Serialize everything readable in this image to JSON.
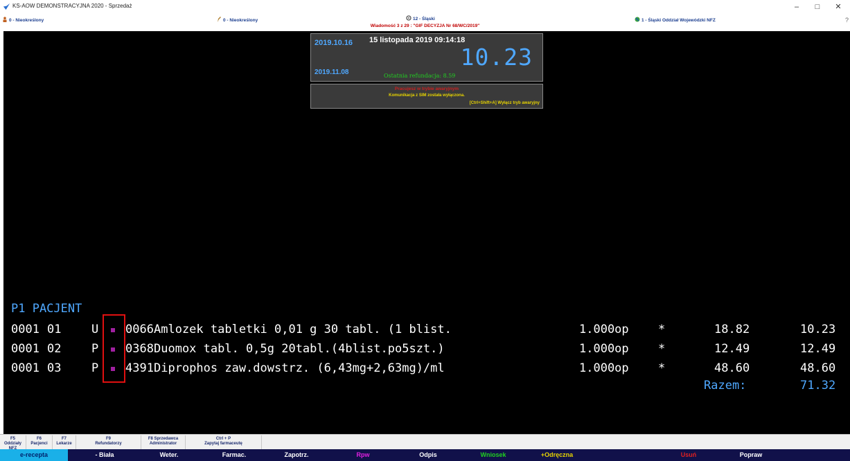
{
  "window": {
    "title": "KS-AOW DEMONSTRACYJNA 2020 - Sprzedaż",
    "minimize": "–",
    "maximize": "□",
    "close": "✕"
  },
  "status": {
    "left1": "0 - Nieokreślony",
    "left2": "0 - Nieokreślony",
    "region": "12 - Śląski",
    "message": "Wiadomość 3 z 29 : \"GIF DECYZJA Nr 68/WC/2019\"",
    "nfz": "1 - Śląski Oddział Wojewódzki NFZ",
    "right_icon": "?"
  },
  "clock": {
    "date1": "2019.10.16",
    "date2": "2019.11.08",
    "datetime": "15 listopada 2019  09:14:18",
    "value": "10.23",
    "last_refund": "Ostatnia refundacja: 8.59"
  },
  "alert": {
    "line1": "Pracujesz w trybie awaryjnym",
    "line2": "Komunikacja z SIM została wyłączona.",
    "line3": "[Ctrl+Shift+A] Wyłącz tryb awaryjny"
  },
  "patient_label": "P1 PACJENT",
  "items": [
    {
      "code": "0001",
      "pos": "01",
      "type": "U",
      "id": "0066",
      "name": "Amlozek tabletki 0,01 g 30 tabl. (1 blist.",
      "qty": "1.000op",
      "star": "*",
      "price": "18.82",
      "pay": "10.23"
    },
    {
      "code": "0001",
      "pos": "02",
      "type": "P",
      "id": "0368",
      "name": "Duomox tabl. 0,5g 20tabl.(4blist.po5szt.)",
      "qty": "1.000op",
      "star": "*",
      "price": "12.49",
      "pay": "12.49"
    },
    {
      "code": "0001",
      "pos": "03",
      "type": "P",
      "id": "4391",
      "name": "Diprophos zaw.dowstrz. (6,43mg+2,63mg)/ml",
      "qty": "1.000op",
      "star": "*",
      "price": "48.60",
      "pay": "48.60"
    }
  ],
  "total": {
    "label": "Razem:",
    "value": "71.32"
  },
  "fkeys": [
    {
      "key": "F5",
      "label": "Oddziały NFZ"
    },
    {
      "key": "F6",
      "label": "Pacjenci"
    },
    {
      "key": "F7",
      "label": "Lekarze"
    },
    {
      "key": "F9",
      "label": "Refundatorzy"
    },
    {
      "key": "F8 Sprzedawca",
      "label": "Administrator"
    },
    {
      "key": "Ctrl + P",
      "label": "Zapytaj farmaceutę"
    }
  ],
  "categories": [
    {
      "label": "e-recepta",
      "color": "#00246e"
    },
    {
      "label": "- Biała",
      "color": "#ffffff"
    },
    {
      "label": "Weter.",
      "color": "#ffffff"
    },
    {
      "label": "Farmac.",
      "color": "#ffffff"
    },
    {
      "label": "Zapotrz.",
      "color": "#ffffff"
    },
    {
      "label": "Rpw",
      "color": "#e020e0"
    },
    {
      "label": "Odpis",
      "color": "#ffffff"
    },
    {
      "label": "Wniosek",
      "color": "#20d020"
    },
    {
      "label": "+Odręczna",
      "color": "#e8d400"
    },
    {
      "label": "Usuń",
      "color": "#e02020"
    },
    {
      "label": "Popraw",
      "color": "#ffffff"
    }
  ]
}
